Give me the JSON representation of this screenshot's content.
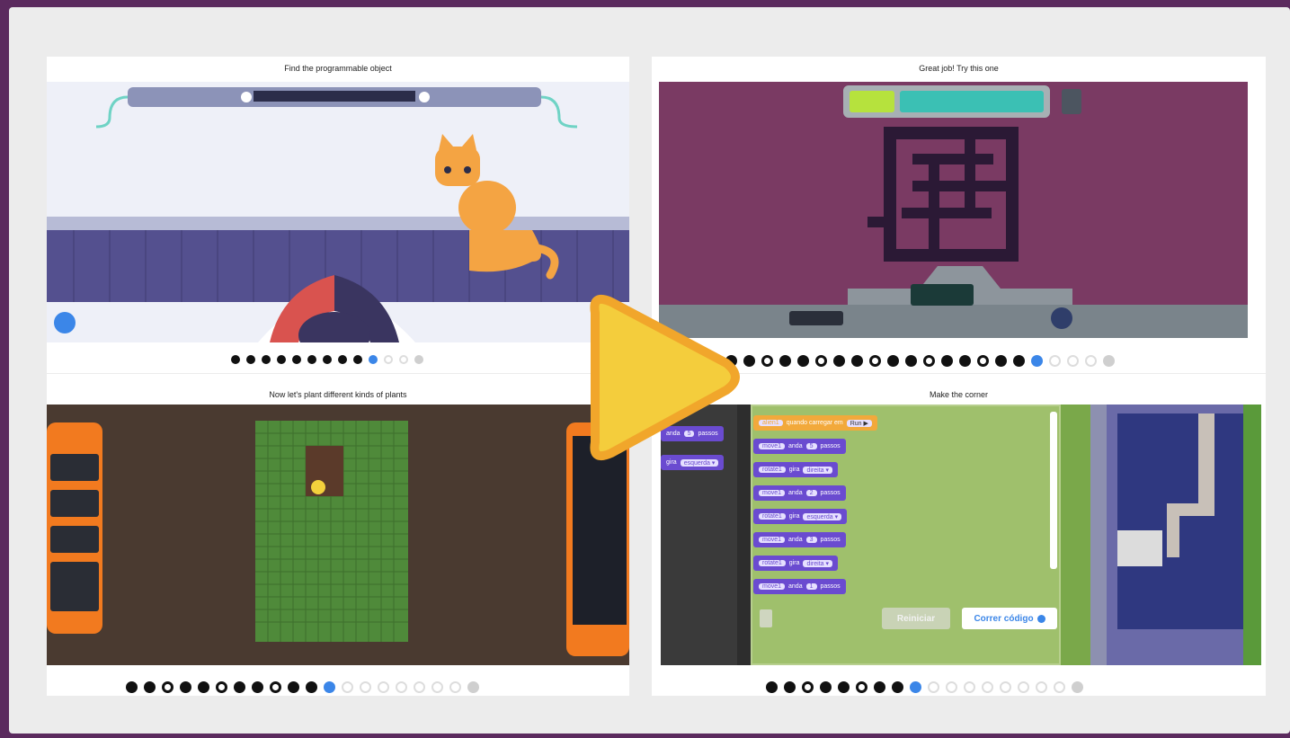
{
  "panels": [
    {
      "title": "Find the programmable object",
      "progress": {
        "done": 9,
        "current": 10,
        "total": 13
      }
    },
    {
      "title": "Great job! Try this one",
      "progress": {
        "done": 17,
        "current": 18,
        "total": 22
      }
    },
    {
      "title": "Now let's plant different kinds of plants",
      "progress": {
        "done": 11,
        "current": 12,
        "total": 20
      }
    },
    {
      "title": "Make the corner",
      "progress": {
        "done": 8,
        "current": 9,
        "total": 18
      }
    }
  ],
  "panel4": {
    "palette": [
      {
        "word": "anda",
        "value": "5",
        "unit": "passos"
      },
      {
        "word": "gira",
        "value": "esquerda ▾"
      }
    ],
    "start_block": {
      "obj": "alien1",
      "text": "quando carregar em",
      "run": "Run ▶"
    },
    "code": [
      {
        "obj": "move1",
        "word": "anda",
        "value": "5",
        "unit": "passos"
      },
      {
        "obj": "rotate1",
        "word": "gira",
        "value": "direita ▾"
      },
      {
        "obj": "move1",
        "word": "anda",
        "value": "2",
        "unit": "passos"
      },
      {
        "obj": "rotate1",
        "word": "gira",
        "value": "esquerda ▾"
      },
      {
        "obj": "move1",
        "word": "anda",
        "value": "3",
        "unit": "passos"
      },
      {
        "obj": "rotate1",
        "word": "gira",
        "value": "direita ▾"
      },
      {
        "obj": "move1",
        "word": "anda",
        "value": "1",
        "unit": "passos"
      }
    ],
    "reset_label": "Reiniciar",
    "run_label": "Correr código"
  },
  "colors": {
    "frame": "#5b2a5e",
    "play": "#f4cd3c",
    "play_stroke": "#f1a62b",
    "current_dot": "#3b86e8"
  }
}
